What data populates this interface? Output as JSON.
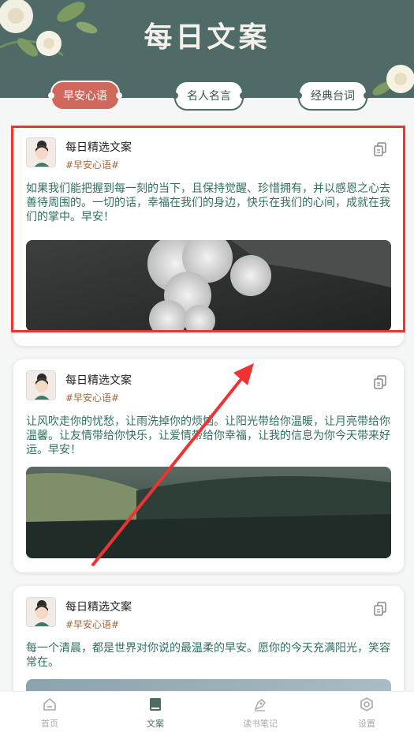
{
  "header": {
    "title": "每日文案"
  },
  "tabs": [
    {
      "label": "早安心语",
      "active": true
    },
    {
      "label": "名人名言",
      "active": false
    },
    {
      "label": "经典台词",
      "active": false
    }
  ],
  "cards": [
    {
      "author": "每日精选文案",
      "tag": "#早安心语#",
      "text": "如果我们能把握到每一刻的当下，且保持觉醒、珍惜拥有，并以感恩之心去善待周围的。一切的话，幸福在我们的身边，快乐在我们的心间，成就在我们的掌中。早安！",
      "photo": "smoke-plume"
    },
    {
      "author": "每日精选文案",
      "tag": "#早安心语#",
      "text": "让风吹走你的忧愁，让雨洗掉你的烦恼。让阳光带给你温暖，让月亮带给你温馨。让友情带给你快乐，让爱情带给你幸福，让我的信息为你今天带来好运。早安！",
      "photo": "pine-forest"
    },
    {
      "author": "每日精选文案",
      "tag": "#早安心语#",
      "text": "每一个清晨，都是世界对你说的最温柔的早安。愿你的今天充满阳光，笑容常在。",
      "photo": "misty-sky"
    }
  ],
  "bottom_nav": [
    {
      "label": "首页",
      "icon": "home-icon",
      "active": false
    },
    {
      "label": "文案",
      "icon": "book-icon",
      "active": true
    },
    {
      "label": "读书笔记",
      "icon": "pen-icon",
      "active": false
    },
    {
      "label": "设置",
      "icon": "settings-icon",
      "active": false
    }
  ],
  "colors": {
    "header": "#4e6b67",
    "active_tab": "#d0675c",
    "body_text": "#2f6f63",
    "tag": "#a0673d",
    "highlight": "#e33333"
  }
}
